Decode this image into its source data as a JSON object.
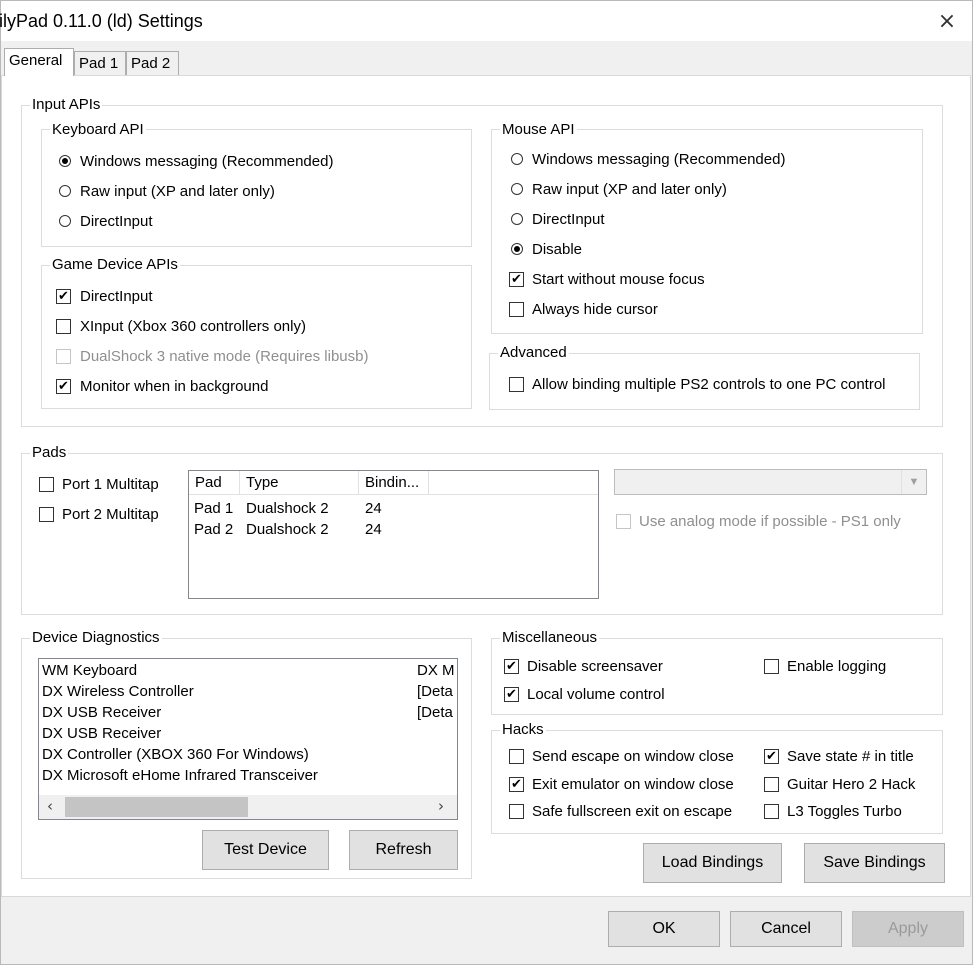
{
  "window": {
    "title": "ilyPad 0.11.0 (ld) Settings",
    "close_icon": "×"
  },
  "tabs": [
    {
      "label": "General"
    },
    {
      "label": "Pad 1"
    },
    {
      "label": "Pad 2"
    }
  ],
  "input_apis": {
    "title": "Input APIs",
    "keyboard": {
      "title": "Keyboard API",
      "options": [
        "Windows messaging (Recommended)",
        "Raw input (XP and later only)",
        "DirectInput"
      ],
      "selected": 0
    },
    "game_device": {
      "title": "Game Device APIs",
      "options": [
        {
          "label": "DirectInput",
          "checked": true,
          "enabled": true
        },
        {
          "label": "XInput (Xbox 360 controllers only)",
          "checked": false,
          "enabled": true
        },
        {
          "label": "DualShock 3 native mode (Requires libusb)",
          "checked": false,
          "enabled": false
        },
        {
          "label": "Monitor when in background",
          "checked": true,
          "enabled": true
        }
      ]
    },
    "mouse": {
      "title": "Mouse API",
      "options": [
        "Windows messaging (Recommended)",
        "Raw input (XP and later only)",
        "DirectInput",
        "Disable"
      ],
      "selected": 3,
      "checks": [
        {
          "label": "Start without mouse focus",
          "checked": true
        },
        {
          "label": "Always hide cursor",
          "checked": false
        }
      ]
    },
    "advanced": {
      "title": "Advanced",
      "checks": [
        {
          "label": "Allow binding multiple PS2 controls to one PC control",
          "checked": false
        }
      ]
    }
  },
  "pads": {
    "title": "Pads",
    "multitap": [
      {
        "label": "Port 1 Multitap",
        "checked": false
      },
      {
        "label": "Port 2 Multitap",
        "checked": false
      }
    ],
    "columns": [
      "Pad",
      "Type",
      "Bindin..."
    ],
    "rows": [
      [
        "Pad 1",
        "Dualshock 2",
        "24"
      ],
      [
        "Pad 2",
        "Dualshock 2",
        "24"
      ]
    ],
    "combo_value": "",
    "analog_label": "Use analog mode if possible - PS1 only"
  },
  "device_diagnostics": {
    "title": "Device Diagnostics",
    "items": [
      {
        "name": "WM Keyboard",
        "detail": "DX M"
      },
      {
        "name": "DX Wireless Controller",
        "detail": "[Deta"
      },
      {
        "name": "DX USB Receiver",
        "detail": "[Deta"
      },
      {
        "name": "DX USB Receiver",
        "detail": ""
      },
      {
        "name": "DX Controller (XBOX 360 For Windows)",
        "detail": ""
      },
      {
        "name": "DX Microsoft eHome Infrared Transceiver",
        "detail": ""
      }
    ],
    "scroll_left_icon": "‹",
    "scroll_right_icon": "›",
    "test_button": "Test Device",
    "refresh_button": "Refresh"
  },
  "miscellaneous": {
    "title": "Miscellaneous",
    "checks": [
      {
        "label": "Disable screensaver",
        "checked": true
      },
      {
        "label": "Enable logging",
        "checked": false
      },
      {
        "label": "Local volume control",
        "checked": true
      }
    ]
  },
  "hacks": {
    "title": "Hacks",
    "checks": [
      {
        "label": "Send escape on window close",
        "checked": false
      },
      {
        "label": "Save state # in title",
        "checked": true
      },
      {
        "label": "Exit emulator on window close",
        "checked": true
      },
      {
        "label": "Guitar Hero 2 Hack",
        "checked": false
      },
      {
        "label": "Safe fullscreen exit on escape",
        "checked": false
      },
      {
        "label": "L3 Toggles Turbo",
        "checked": false
      }
    ]
  },
  "bindings": {
    "load": "Load Bindings",
    "save": "Save Bindings"
  },
  "footer": {
    "ok": "OK",
    "cancel": "Cancel",
    "apply": "Apply"
  },
  "check_mark": "✔"
}
